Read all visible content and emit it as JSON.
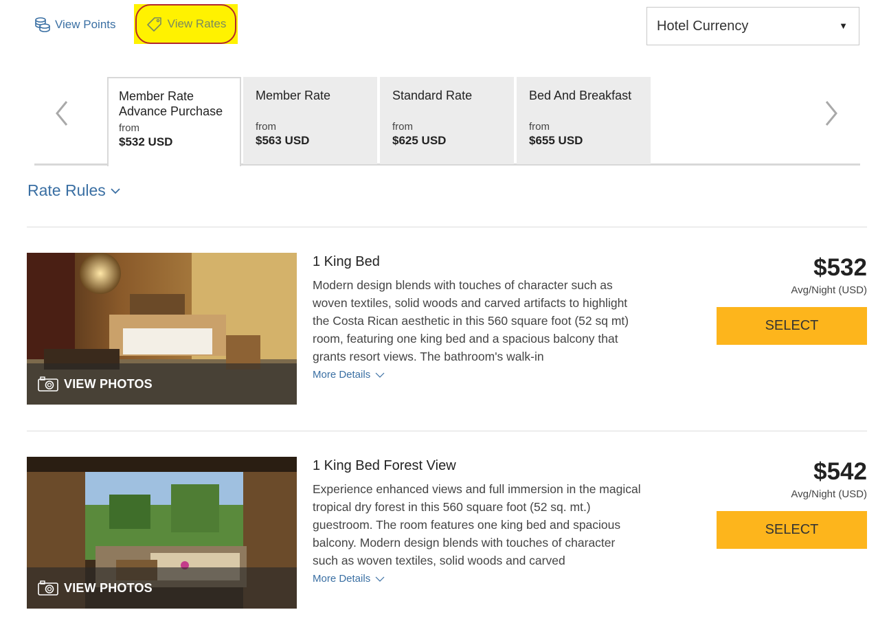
{
  "toolbar": {
    "view_points_label": "View Points",
    "view_rates_label": "View Rates",
    "currency_select": "Hotel Currency"
  },
  "rate_tabs": [
    {
      "title": "Member Rate Advance Purchase",
      "from": "from",
      "price": "$532 USD",
      "active": true
    },
    {
      "title": "Member Rate",
      "from": "from",
      "price": "$563 USD",
      "active": false
    },
    {
      "title": "Standard Rate",
      "from": "from",
      "price": "$625 USD",
      "active": false
    },
    {
      "title": "Bed And Breakfast",
      "from": "from",
      "price": "$655 USD",
      "active": false
    }
  ],
  "rate_rules_label": "Rate Rules",
  "rooms": [
    {
      "name": "1 King Bed",
      "description": "Modern design blends with touches of character such as woven textiles, solid woods and carved artifacts to highlight the Costa Rican aesthetic in this 560 square foot (52 sq mt) room, featuring one king bed and a spacious balcony that grants resort views. The bathroom's walk-in",
      "more_details": "More Details",
      "view_photos": "VIEW PHOTOS",
      "price": "$532",
      "price_unit": "Avg/Night (USD)",
      "select_label": "SELECT"
    },
    {
      "name": "1 King Bed Forest View",
      "description": "Experience enhanced views and full immersion in the magical tropical dry forest in this 560 square foot (52 sq. mt.) guestroom. The room features one king bed and spacious balcony. Modern design blends with touches of character such as woven textiles, solid woods and carved",
      "more_details": "More Details",
      "view_photos": "VIEW PHOTOS",
      "price": "$542",
      "price_unit": "Avg/Night (USD)",
      "select_label": "SELECT"
    }
  ],
  "colors": {
    "link": "#3a6fa3",
    "select_button": "#fdb51c",
    "highlight": "#fff200",
    "highlight_border": "#b3272c"
  }
}
